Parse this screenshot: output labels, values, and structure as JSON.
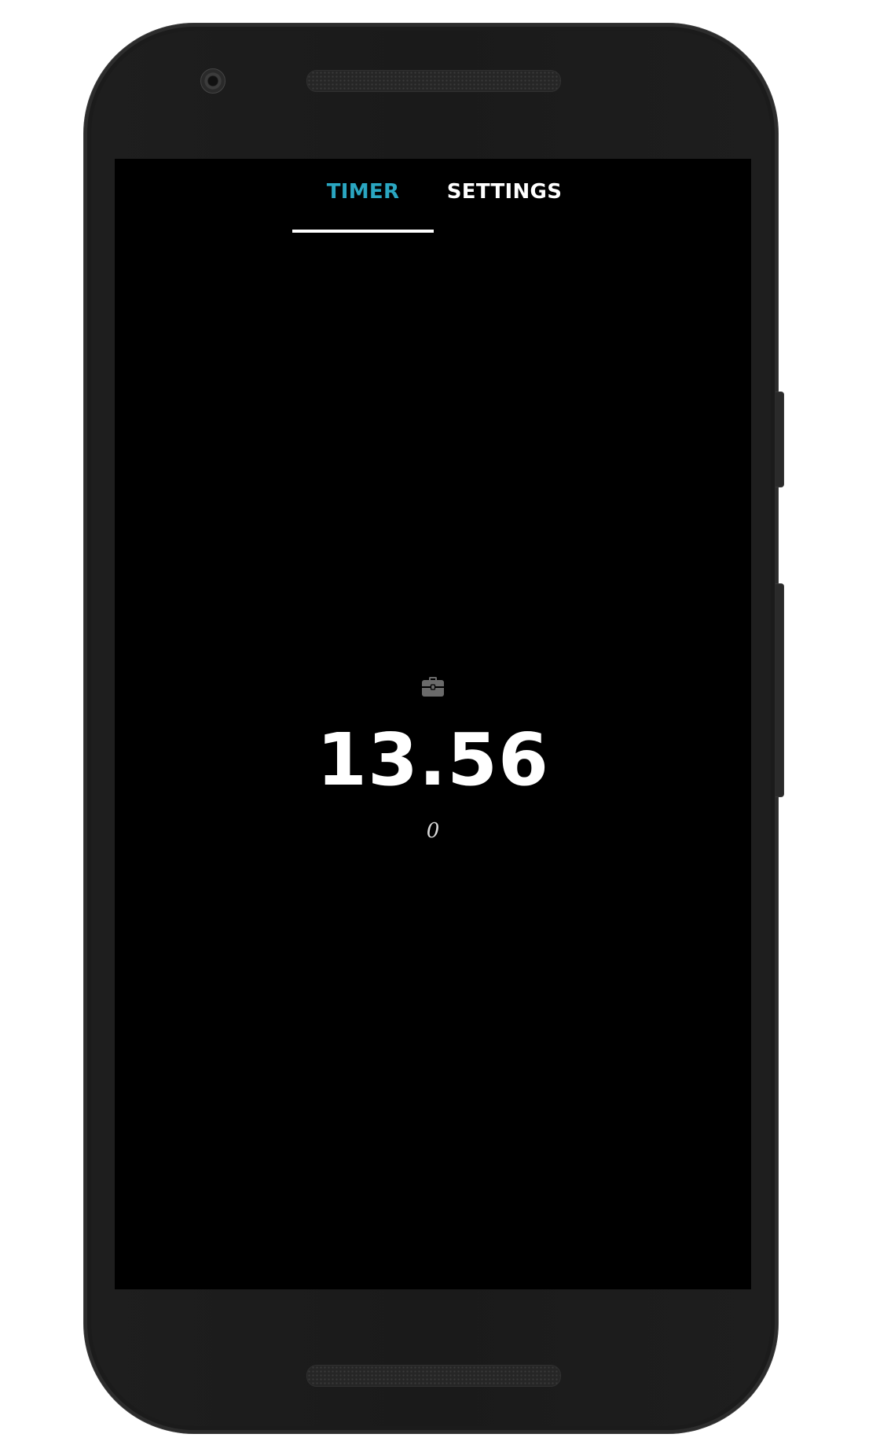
{
  "tabs": {
    "timer_label": "TIMER",
    "settings_label": "SETTINGS",
    "active": "TIMER"
  },
  "timer": {
    "icon": "briefcase-icon",
    "time": "13.56",
    "count": "0"
  },
  "colors": {
    "accent": "#2aa6c1",
    "screen_background": "#000000",
    "device_body": "#1b1b1b"
  }
}
